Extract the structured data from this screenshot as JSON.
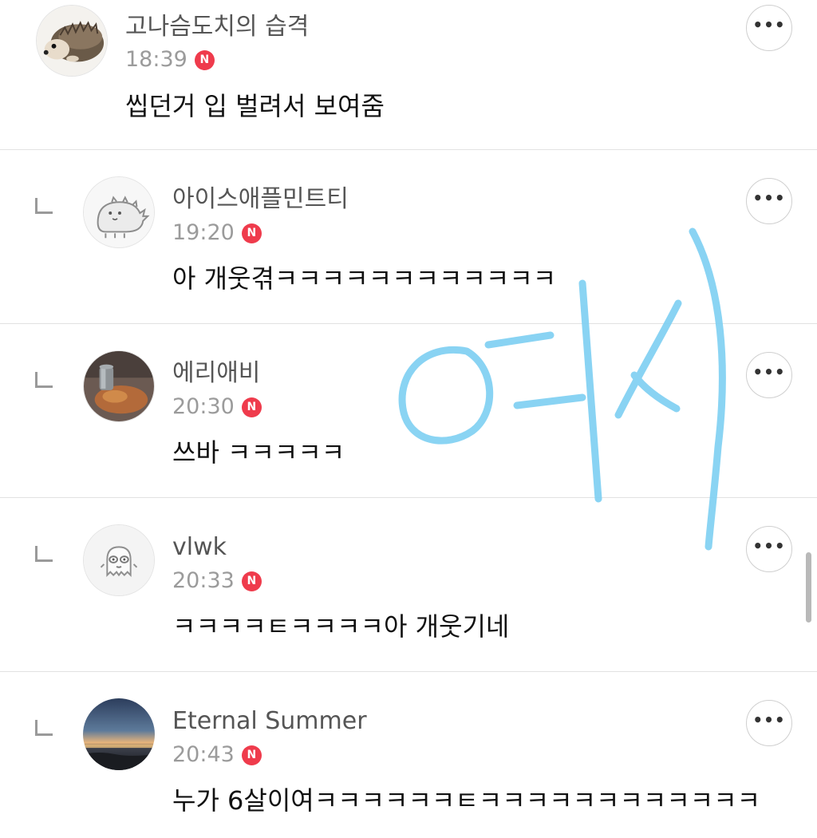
{
  "comments": [
    {
      "author": "고나슴도치의 습격",
      "time": "18:39",
      "badge": "N",
      "text": "씹던거 입 벌려서 보여줌",
      "avatar_icon": "hedgehog-avatar",
      "more_label": "•••"
    },
    {
      "author": "아이스애플민트티",
      "time": "19:20",
      "badge": "N",
      "text": "아 개웃겪ㅋㅋㅋㅋㅋㅋㅋㅋㅋㅋㅋㅋ",
      "avatar_icon": "dinosaur-sticker-avatar",
      "more_label": "•••"
    },
    {
      "author": "에리애비",
      "time": "20:30",
      "badge": "N",
      "text": "쓰바 ㅋㅋㅋㅋㅋ",
      "avatar_icon": "photo-avatar",
      "more_label": "•••"
    },
    {
      "author": "vlwk",
      "time": "20:33",
      "badge": "N",
      "text": "ㅋㅋㅋㅋㅌㅋㅋㅋㅋ아 개웃기네",
      "avatar_icon": "default-character-avatar",
      "more_label": "•••"
    },
    {
      "author": "Eternal Summer",
      "time": "20:43",
      "badge": "N",
      "text": "누가 6살이여ㅋㅋㅋㅋㅋㅋㅌㅋㅋㅋㅋㅋㅋㅋㅋㅋㅋㅋㅋ",
      "avatar_icon": "sunset-avatar",
      "more_label": "•••"
    }
  ],
  "colors": {
    "author": "#555555",
    "time": "#9b9b9b",
    "badge": "#ef3b4c",
    "divider": "#e2e2e2",
    "handwriting": "#7dcff2"
  }
}
